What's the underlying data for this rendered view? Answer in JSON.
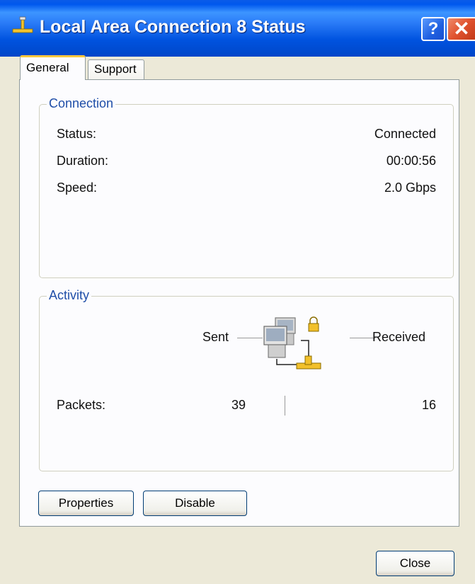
{
  "window": {
    "title": "Local Area Connection 8 Status",
    "help_glyph": "?",
    "close_glyph": "✕"
  },
  "tabs": [
    {
      "label": "General",
      "selected": true
    },
    {
      "label": "Support",
      "selected": false
    }
  ],
  "connection": {
    "legend": "Connection",
    "rows": [
      {
        "label": "Status:",
        "value": "Connected"
      },
      {
        "label": "Duration:",
        "value": "00:00:56"
      },
      {
        "label": "Speed:",
        "value": "2.0 Gbps"
      }
    ]
  },
  "activity": {
    "legend": "Activity",
    "sent_label": "Sent",
    "received_label": "Received",
    "packets_label": "Packets:",
    "packets_sent": "39",
    "packets_received": "16",
    "icon": "network-computers-icon"
  },
  "buttons": {
    "properties": "Properties",
    "disable": "Disable",
    "close": "Close"
  },
  "colors": {
    "titlebar": "#0058ee",
    "dialog_bg": "#ece9d8",
    "legend_text": "#1f4ea8",
    "tab_highlight": "#ffc83c"
  }
}
